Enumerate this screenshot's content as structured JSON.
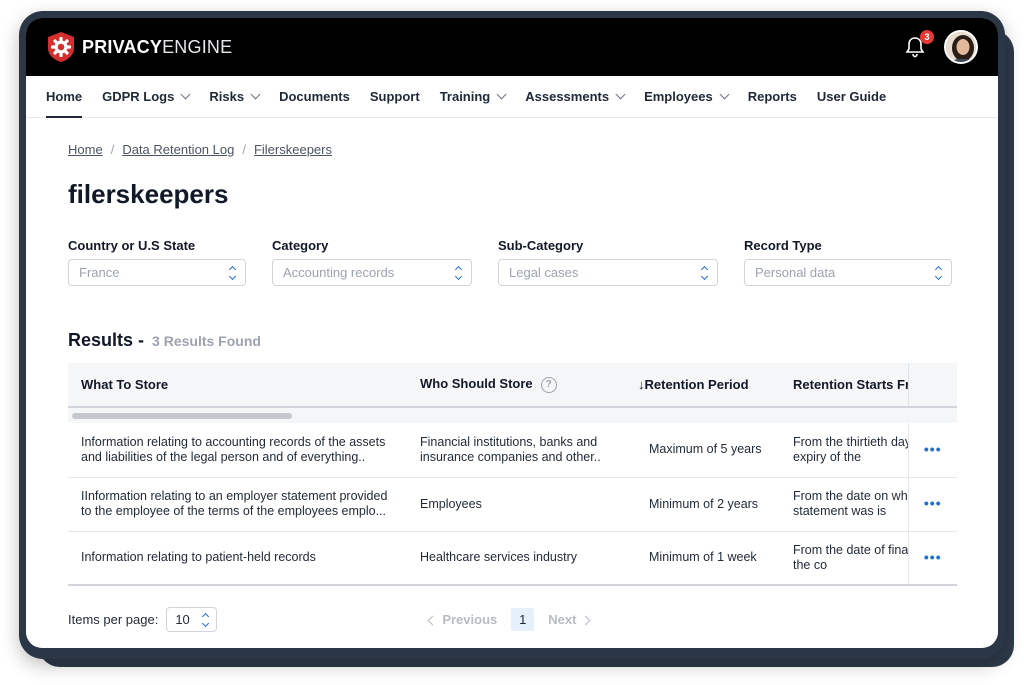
{
  "brand": {
    "name_bold": "PRIVACY",
    "name_regular": "ENGINE",
    "accent": "#d32f2f"
  },
  "notifications": {
    "count": "3"
  },
  "nav": {
    "items": [
      {
        "label": "Home",
        "dropdown": false,
        "active": true
      },
      {
        "label": "GDPR Logs",
        "dropdown": true
      },
      {
        "label": "Risks",
        "dropdown": true
      },
      {
        "label": "Documents",
        "dropdown": false
      },
      {
        "label": "Support",
        "dropdown": false
      },
      {
        "label": "Training",
        "dropdown": true
      },
      {
        "label": "Assessments",
        "dropdown": true
      },
      {
        "label": "Employees",
        "dropdown": true
      },
      {
        "label": "Reports",
        "dropdown": false
      },
      {
        "label": "User Guide",
        "dropdown": false
      }
    ]
  },
  "breadcrumb": {
    "items": [
      "Home",
      "Data Retention Log",
      "Filerskeepers"
    ],
    "separator": "/"
  },
  "page_title": "filerskeepers",
  "filters": [
    {
      "label": "Country or U.S State",
      "value": "France"
    },
    {
      "label": "Category",
      "value": "Accounting records"
    },
    {
      "label": "Sub-Category",
      "value": "Legal cases"
    },
    {
      "label": "Record Type",
      "value": "Personal data"
    }
  ],
  "results": {
    "title": "Results -",
    "count_text": "3 Results Found"
  },
  "table": {
    "headers": [
      "What To Store",
      "Who Should Store",
      "Retention Period",
      "Retention Starts From"
    ],
    "help_icon": "?",
    "sort_arrow": "↓",
    "rows": [
      {
        "what": "Information relating to accounting records of the assets and liabilities of the legal person and of everything..",
        "who": "Financial institutions, banks and insurance companies and other..",
        "period": "Maximum of 5 years",
        "starts": "From the thirtieth day after the expiry of the"
      },
      {
        "what": "IInformation relating to an employer statement provided to the employee of the terms of the employees emplo...",
        "who": "Employees",
        "period": "Minimum of 2 years",
        "starts": "From the date on which that statement was is"
      },
      {
        "what": "Information relating to patient-held records",
        "who": "Healthcare services industry",
        "period": "Minimum of 1 week",
        "starts": "From the date of final dissolution of the co"
      }
    ],
    "row_action": "•••"
  },
  "footer": {
    "items_per_page_label": "Items per page:",
    "items_per_page_value": "10",
    "previous": "Previous",
    "next": "Next",
    "current_page": "1"
  },
  "colors": {
    "link_blue": "#1e6fd9",
    "topbar": "#000000",
    "frame": "#2b3646"
  }
}
